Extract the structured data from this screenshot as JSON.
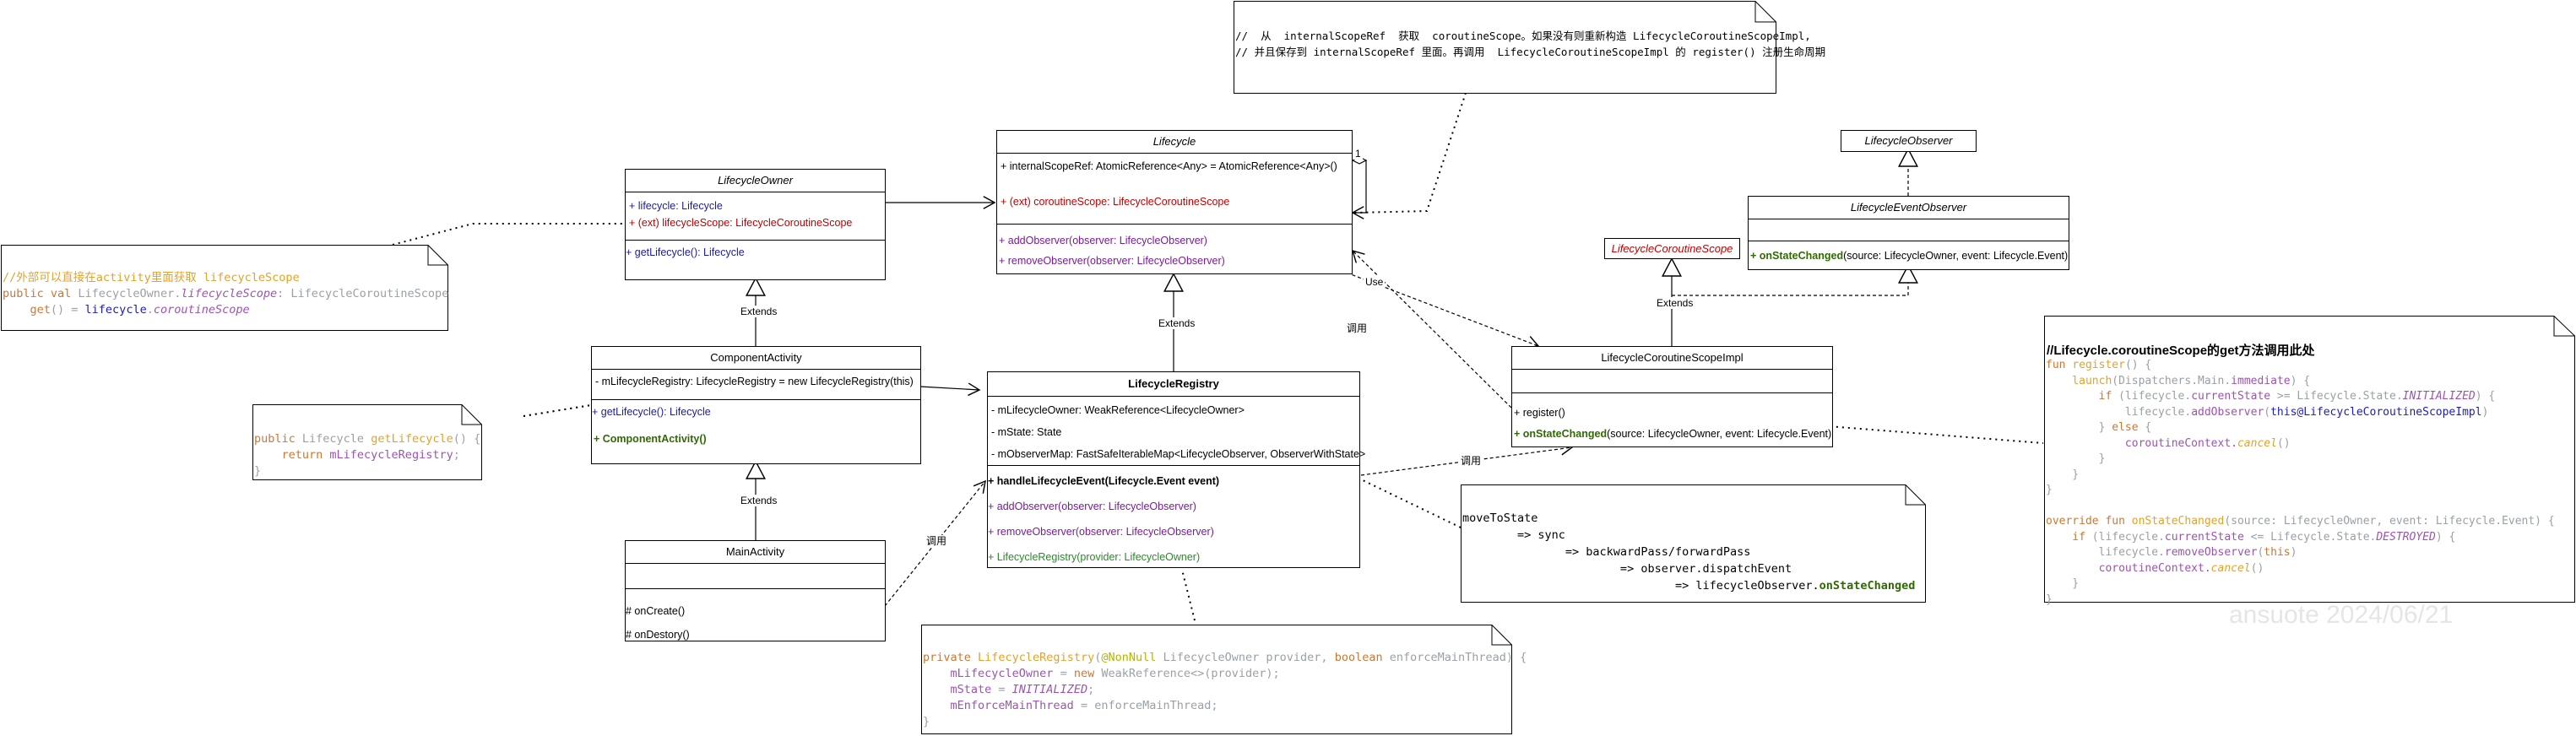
{
  "notes": {
    "top_line1": "//  从  internalScopeRef  获取  coroutineScope。如果没有则重新构造 LifecycleCoroutineScopeImpl,",
    "top_line2": "// 并且保存到 internalScopeRef 里面。再调用  LifecycleCoroutineScopeImpl 的 register() 注册生命周期",
    "left_comment": "//外部可以直接在activity里面获取 lifecycleScope",
    "left_l2_a": "public val ",
    "left_l2_b": "LifecycleOwner.",
    "left_l2_c": "lifecycleScope",
    "left_l2_d": ": LifecycleCoroutineScope",
    "left_l3_a": "    get",
    "left_l3_b": "() = ",
    "left_l3_c": "lifecycle",
    "left_l3_d": ".",
    "left_l3_e": "coroutineScope",
    "getlc_l1_a": "public ",
    "getlc_l1_b": "Lifecycle ",
    "getlc_l1_c": "getLifecycle",
    "getlc_l1_d": "() {",
    "getlc_l2_a": "    return ",
    "getlc_l2_b": "mLifecycleRegistry",
    "getlc_l2_c": ";",
    "getlc_l3": "}",
    "reg_l1_a": "private ",
    "reg_l1_b": "LifecycleRegistry",
    "reg_l1_c": "(",
    "reg_l1_d": "@NonNull ",
    "reg_l1_e": "LifecycleOwner provider, ",
    "reg_l1_f": "boolean ",
    "reg_l1_g": "enforceMainThread) {",
    "reg_l2_a": "    mLifecycleOwner",
    "reg_l2_b": " = ",
    "reg_l2_c": "new ",
    "reg_l2_d": "WeakReference<>(provider);",
    "reg_l3_a": "    mState",
    "reg_l3_b": " = ",
    "reg_l3_c": "INITIALIZED",
    "reg_l3_d": ";",
    "reg_l4_a": "    mEnforceMainThread",
    "reg_l4_b": " = enforceMainThread;",
    "reg_l5": "}",
    "move_l1": "moveToState",
    "move_l2": "        => sync",
    "move_l3": "               => backwardPass/forwardPass",
    "move_l4": "                       => observer.dispatchEvent",
    "move_l5_a": "                               => lifecycleObserver.",
    "move_l5_b": "onStateChanged",
    "right_title": "//Lifecycle.coroutineScope的get方法调用此处",
    "r1_a": "fun ",
    "r1_b": "register",
    "r1_c": "() {",
    "r2_a": "    launch",
    "r2_b": "(Dispatchers.Main.",
    "r2_c": "immediate",
    "r2_d": ") {",
    "r3_a": "        if ",
    "r3_b": "(lifecycle.",
    "r3_c": "currentState",
    "r3_d": " >= Lifecycle.State.",
    "r3_e": "INITIALIZED",
    "r3_f": ") {",
    "r4_a": "            lifecycle.",
    "r4_b": "addObserver",
    "r4_c": "(",
    "r4_d": "this@LifecycleCoroutineScopeImpl",
    "r4_e": ")",
    "r5_a": "        } ",
    "r5_b": "else ",
    "r5_c": "{",
    "r6_a": "            coroutineContext.",
    "r6_b": "cancel",
    "r6_c": "()",
    "r7": "        }",
    "r8": "    }",
    "r9": "}",
    "r11_a": "override fun ",
    "r11_b": "onStateChanged",
    "r11_c": "(source: LifecycleOwner, event: Lifecycle.Event) {",
    "r12_a": "    if ",
    "r12_b": "(lifecycle.",
    "r12_c": "currentState",
    "r12_d": " <= Lifecycle.State.",
    "r12_e": "DESTROYED",
    "r12_f": ") {",
    "r13_a": "        lifecycle.",
    "r13_b": "removeObserver",
    "r13_c": "(",
    "r13_d": "this",
    "r13_e": ")",
    "r14_a": "        coroutineContext.",
    "r14_b": "cancel",
    "r14_c": "()",
    "r15": "    }",
    "r16": "}"
  },
  "classes": {
    "lifecycleOwner": {
      "name": "LifecycleOwner",
      "attr1": "+ lifecycle: Lifecycle",
      "attr2": "+ (ext) lifecycleScope: LifecycleCoroutineScope",
      "op1": "+ getLifecycle(): Lifecycle"
    },
    "lifecycle": {
      "name": "Lifecycle",
      "attr1": "+ internalScopeRef: AtomicReference<Any> = AtomicReference<Any>()",
      "attr2": "+ (ext)  coroutineScope: LifecycleCoroutineScope",
      "op1": "+ addObserver(observer: LifecycleObserver)",
      "op2": "+ removeObserver(observer: LifecycleObserver)"
    },
    "componentActivity": {
      "name": "ComponentActivity",
      "attr1": "- mLifecycleRegistry: LifecycleRegistry = new LifecycleRegistry(this)",
      "op1": "+ getLifecycle(): Lifecycle",
      "op2": "+ ComponentActivity()"
    },
    "mainActivity": {
      "name": "MainActivity",
      "op1": "# onCreate()",
      "op2": "# onDestory()"
    },
    "lifecycleRegistry": {
      "name": "LifecycleRegistry",
      "attr1": "- mLifecycleOwner: WeakReference<LifecycleOwner>",
      "attr2": "- mState: State",
      "attr3": "- mObserverMap: FastSafeIterableMap<LifecycleObserver, ObserverWithState>",
      "op1": "+ handleLifecycleEvent(Lifecycle.Event event)",
      "op2": "+ addObserver(observer: LifecycleObserver)",
      "op3": "+ removeObserver(observer: LifecycleObserver)",
      "op4": "+ LifecycleRegistry(provider: LifecycleOwner)"
    },
    "lifecycleObserver": {
      "name": "LifecycleObserver"
    },
    "lifecycleEventObserver": {
      "name": "LifecycleEventObserver",
      "op1_a": "+ onStateChanged",
      "op1_b": "(source: LifecycleOwner, event: Lifecycle.Event)"
    },
    "lifecycleCoroutineScope": {
      "name": "LifecycleCoroutineScope"
    },
    "lifecycleCoroutineScopeImpl": {
      "name": "LifecycleCoroutineScopeImpl",
      "op1": "+ register()",
      "op2_a": "+ onStateChanged",
      "op2_b": "(source: LifecycleOwner, event: Lifecycle.Event)"
    }
  },
  "edges": {
    "extends": "Extends",
    "use": "Use",
    "call": "调用",
    "multiplicity": "1"
  },
  "watermark": "ansuote 2024/06/21"
}
